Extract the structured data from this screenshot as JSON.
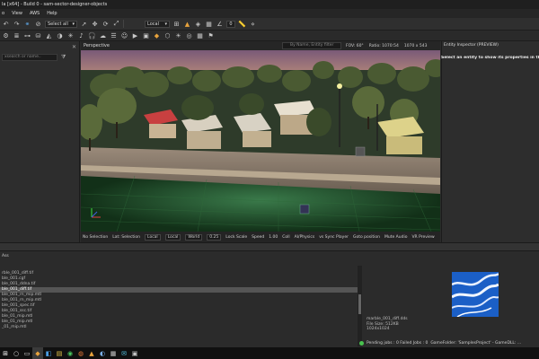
{
  "window": {
    "title": "la [x64] - Build 0 - sam-sector-designer-objects"
  },
  "menu": [
    "o",
    "View",
    "AWS",
    "Help"
  ],
  "toolbar": {
    "select_label": "Select all",
    "coord_label": "Local",
    "snap_value": "0"
  },
  "left_panel": {
    "search_placeholder": "xsearch or name.."
  },
  "viewport": {
    "tab": "Perspective",
    "search_placeholder": "By Name, Entity filter",
    "fov": "FOV: 60°",
    "ratio": "Ratio: 1070:54",
    "resolution": "1070 x 543",
    "status": [
      "No Selection",
      "Lat: Selection",
      "Local",
      "Local",
      "World",
      "0.25",
      "Lock Scale",
      "Speed",
      "1.00",
      "Coll",
      "AI/Physics",
      "vs Sync Player",
      "Goto position",
      "Mute Audio",
      "VR Preview"
    ]
  },
  "inspector": {
    "tab": "Entity Inspector (PREVIEW)",
    "message": "Select an entity to show its properties in the"
  },
  "assets": {
    "header": "Ass",
    "files": [
      "rble_001_diff.tif",
      "ble_001.cgf",
      "ble_001_ddna.tif",
      "ble_001_diff.tif",
      "ble_001_rn_mip.mtl",
      "ble_001_rn_mip.mtl",
      "ble_001_spec.tif",
      "ble_001_ssc.tif",
      "ble_01_mip.mtl",
      "ble_01_mip.mtl",
      "_01_mip.mtl"
    ],
    "selected_index": 3,
    "preview": {
      "name": "marble_001_diff.dds",
      "size": "File Size: 512KB",
      "dims": "1024x1024"
    }
  },
  "status": {
    "jobs": "Pending jobs : 0  Failed Jobs : 0",
    "project": "GameFolder: 'SamplesProject' - GameDLL: ..."
  },
  "taskbar_icons": [
    "windows-logo",
    "cortana",
    "explorer",
    "chrome",
    "firefox",
    "vlc",
    "media",
    "chat",
    "store",
    "lumberyard",
    "editor",
    "folder",
    "terminal"
  ],
  "colors": {
    "accent": "#e8a33d",
    "selection": "#555555",
    "preview_blue": "#1b62c8",
    "ok_green": "#49c24f"
  }
}
